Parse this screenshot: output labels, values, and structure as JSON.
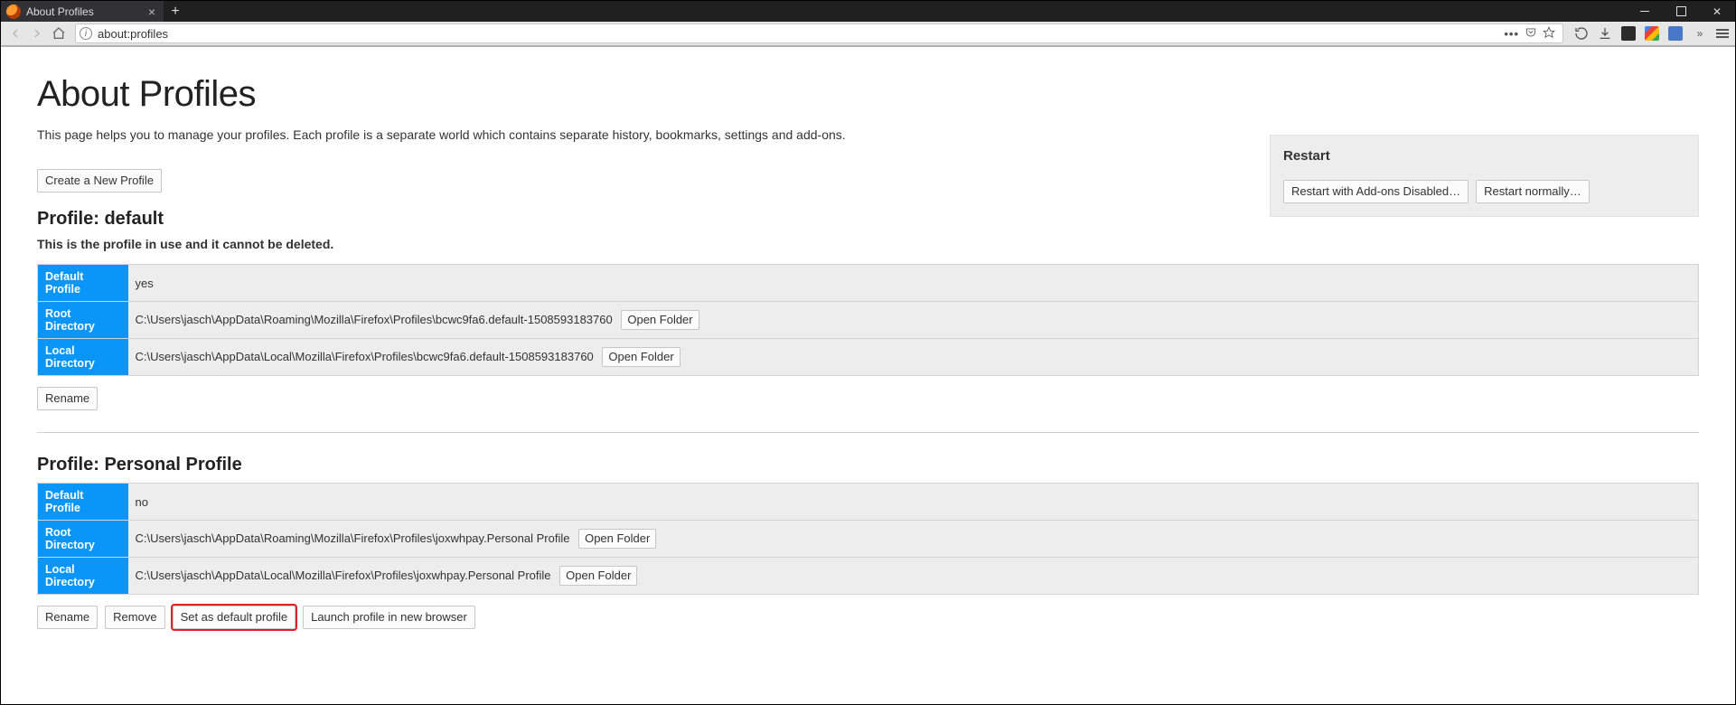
{
  "window": {
    "tab_title": "About Profiles",
    "url": "about:profiles"
  },
  "page": {
    "title": "About Profiles",
    "intro": "This page helps you to manage your profiles. Each profile is a separate world which contains separate history, bookmarks, settings and add-ons.",
    "create_button": "Create a New Profile"
  },
  "restart": {
    "heading": "Restart",
    "disabled_btn": "Restart with Add-ons Disabled…",
    "normal_btn": "Restart normally…"
  },
  "fields": {
    "default_profile": "Default Profile",
    "root_dir": "Root Directory",
    "local_dir": "Local Directory",
    "open_folder": "Open Folder"
  },
  "actions": {
    "rename": "Rename",
    "remove": "Remove",
    "set_default": "Set as default profile",
    "launch": "Launch profile in new browser"
  },
  "profile1": {
    "heading": "Profile: default",
    "note": "This is the profile in use and it cannot be deleted.",
    "is_default": "yes",
    "root": "C:\\Users\\jasch\\AppData\\Roaming\\Mozilla\\Firefox\\Profiles\\bcwc9fa6.default-1508593183760",
    "local": "C:\\Users\\jasch\\AppData\\Local\\Mozilla\\Firefox\\Profiles\\bcwc9fa6.default-1508593183760"
  },
  "profile2": {
    "heading": "Profile: Personal Profile",
    "is_default": "no",
    "root": "C:\\Users\\jasch\\AppData\\Roaming\\Mozilla\\Firefox\\Profiles\\joxwhpay.Personal Profile",
    "local": "C:\\Users\\jasch\\AppData\\Local\\Mozilla\\Firefox\\Profiles\\joxwhpay.Personal Profile"
  }
}
